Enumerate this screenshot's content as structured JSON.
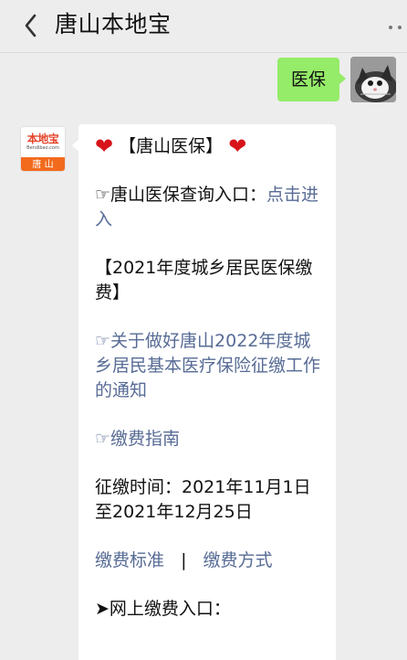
{
  "header": {
    "title": "唐山本地宝",
    "back_icon": "chevron-left-icon",
    "more_icon": "more-dots-icon"
  },
  "messages": {
    "outgoing": {
      "text": "医保",
      "avatar_icon": "cat-avatar"
    },
    "incoming": {
      "avatar": {
        "brand_text": "本地宝",
        "domain_text": "Bendibao.com",
        "city_text": "唐 山"
      },
      "heading": {
        "left_heart": "❤",
        "text": "【唐山医保】",
        "right_heart": "❤"
      },
      "query": {
        "prefix": "☞唐山医保查询入口：",
        "link": "点击进入"
      },
      "section_title": "【2021年度城乡居民医保缴费】",
      "notice_link": "☞关于做好唐山2022年度城乡居民基本医疗保险征缴工作的通知",
      "guide_link": "☞缴费指南",
      "collection_time": "征缴时间：2021年11月1日至2021年12月25日",
      "standard_link": "缴费标准",
      "divider": "|",
      "method_link": "缴费方式",
      "online_payment": "➤网上缴费入口："
    }
  },
  "colors": {
    "background": "#ededed",
    "outgoing_bubble": "#95ec69",
    "incoming_bubble": "#ffffff",
    "link": "#576b95",
    "heart": "#d7141a",
    "logo_red": "#e5432a",
    "logo_orange": "#f26b1d"
  }
}
